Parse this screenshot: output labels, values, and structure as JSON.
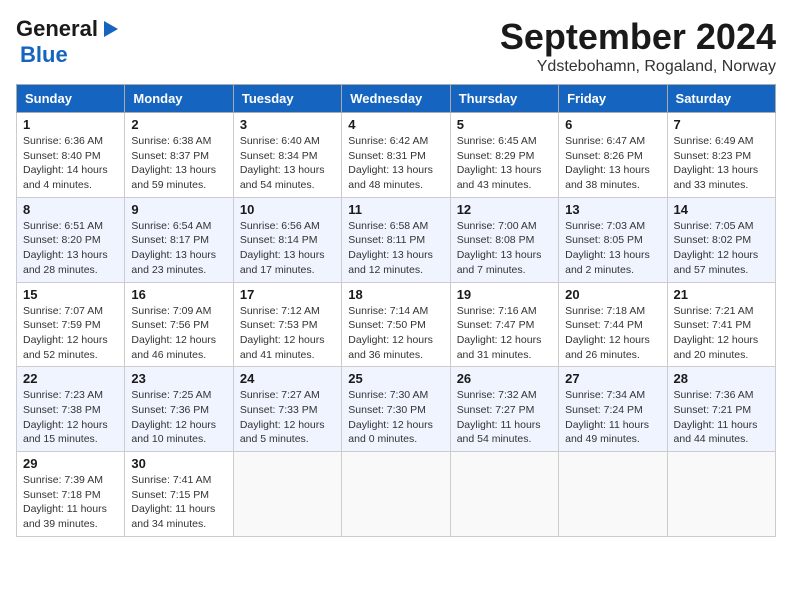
{
  "logo": {
    "line1": "General",
    "line2": "Blue",
    "arrow": "▶"
  },
  "title": "September 2024",
  "location": "Ydstebohamn, Rogaland, Norway",
  "headers": [
    "Sunday",
    "Monday",
    "Tuesday",
    "Wednesday",
    "Thursday",
    "Friday",
    "Saturday"
  ],
  "weeks": [
    [
      {
        "day": "1",
        "sunrise": "6:36 AM",
        "sunset": "8:40 PM",
        "daylight": "14 hours and 4 minutes."
      },
      {
        "day": "2",
        "sunrise": "6:38 AM",
        "sunset": "8:37 PM",
        "daylight": "13 hours and 59 minutes."
      },
      {
        "day": "3",
        "sunrise": "6:40 AM",
        "sunset": "8:34 PM",
        "daylight": "13 hours and 54 minutes."
      },
      {
        "day": "4",
        "sunrise": "6:42 AM",
        "sunset": "8:31 PM",
        "daylight": "13 hours and 48 minutes."
      },
      {
        "day": "5",
        "sunrise": "6:45 AM",
        "sunset": "8:29 PM",
        "daylight": "13 hours and 43 minutes."
      },
      {
        "day": "6",
        "sunrise": "6:47 AM",
        "sunset": "8:26 PM",
        "daylight": "13 hours and 38 minutes."
      },
      {
        "day": "7",
        "sunrise": "6:49 AM",
        "sunset": "8:23 PM",
        "daylight": "13 hours and 33 minutes."
      }
    ],
    [
      {
        "day": "8",
        "sunrise": "6:51 AM",
        "sunset": "8:20 PM",
        "daylight": "13 hours and 28 minutes."
      },
      {
        "day": "9",
        "sunrise": "6:54 AM",
        "sunset": "8:17 PM",
        "daylight": "13 hours and 23 minutes."
      },
      {
        "day": "10",
        "sunrise": "6:56 AM",
        "sunset": "8:14 PM",
        "daylight": "13 hours and 17 minutes."
      },
      {
        "day": "11",
        "sunrise": "6:58 AM",
        "sunset": "8:11 PM",
        "daylight": "13 hours and 12 minutes."
      },
      {
        "day": "12",
        "sunrise": "7:00 AM",
        "sunset": "8:08 PM",
        "daylight": "13 hours and 7 minutes."
      },
      {
        "day": "13",
        "sunrise": "7:03 AM",
        "sunset": "8:05 PM",
        "daylight": "13 hours and 2 minutes."
      },
      {
        "day": "14",
        "sunrise": "7:05 AM",
        "sunset": "8:02 PM",
        "daylight": "12 hours and 57 minutes."
      }
    ],
    [
      {
        "day": "15",
        "sunrise": "7:07 AM",
        "sunset": "7:59 PM",
        "daylight": "12 hours and 52 minutes."
      },
      {
        "day": "16",
        "sunrise": "7:09 AM",
        "sunset": "7:56 PM",
        "daylight": "12 hours and 46 minutes."
      },
      {
        "day": "17",
        "sunrise": "7:12 AM",
        "sunset": "7:53 PM",
        "daylight": "12 hours and 41 minutes."
      },
      {
        "day": "18",
        "sunrise": "7:14 AM",
        "sunset": "7:50 PM",
        "daylight": "12 hours and 36 minutes."
      },
      {
        "day": "19",
        "sunrise": "7:16 AM",
        "sunset": "7:47 PM",
        "daylight": "12 hours and 31 minutes."
      },
      {
        "day": "20",
        "sunrise": "7:18 AM",
        "sunset": "7:44 PM",
        "daylight": "12 hours and 26 minutes."
      },
      {
        "day": "21",
        "sunrise": "7:21 AM",
        "sunset": "7:41 PM",
        "daylight": "12 hours and 20 minutes."
      }
    ],
    [
      {
        "day": "22",
        "sunrise": "7:23 AM",
        "sunset": "7:38 PM",
        "daylight": "12 hours and 15 minutes."
      },
      {
        "day": "23",
        "sunrise": "7:25 AM",
        "sunset": "7:36 PM",
        "daylight": "12 hours and 10 minutes."
      },
      {
        "day": "24",
        "sunrise": "7:27 AM",
        "sunset": "7:33 PM",
        "daylight": "12 hours and 5 minutes."
      },
      {
        "day": "25",
        "sunrise": "7:30 AM",
        "sunset": "7:30 PM",
        "daylight": "12 hours and 0 minutes."
      },
      {
        "day": "26",
        "sunrise": "7:32 AM",
        "sunset": "7:27 PM",
        "daylight": "11 hours and 54 minutes."
      },
      {
        "day": "27",
        "sunrise": "7:34 AM",
        "sunset": "7:24 PM",
        "daylight": "11 hours and 49 minutes."
      },
      {
        "day": "28",
        "sunrise": "7:36 AM",
        "sunset": "7:21 PM",
        "daylight": "11 hours and 44 minutes."
      }
    ],
    [
      {
        "day": "29",
        "sunrise": "7:39 AM",
        "sunset": "7:18 PM",
        "daylight": "11 hours and 39 minutes."
      },
      {
        "day": "30",
        "sunrise": "7:41 AM",
        "sunset": "7:15 PM",
        "daylight": "11 hours and 34 minutes."
      },
      null,
      null,
      null,
      null,
      null
    ]
  ]
}
